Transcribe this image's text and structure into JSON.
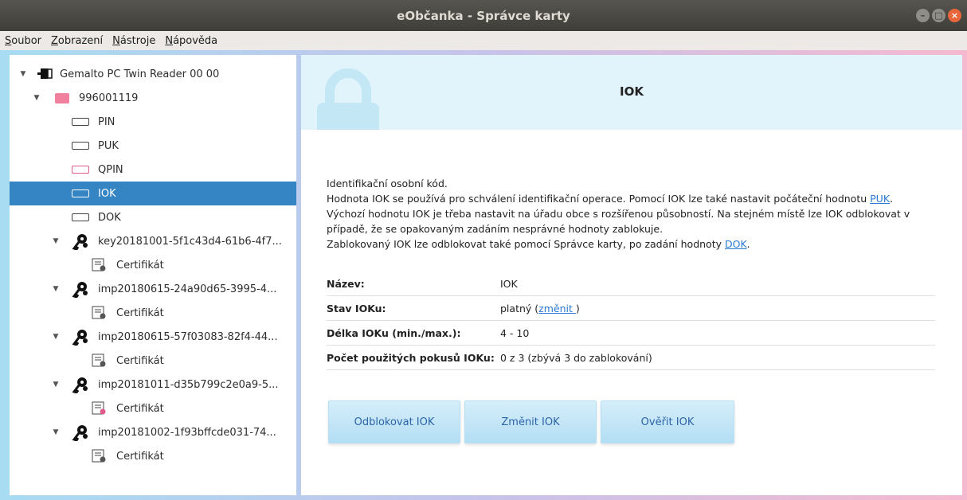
{
  "window": {
    "title": "eObčanka - Správce karty"
  },
  "menu": {
    "soubor": {
      "accel": "S",
      "rest": "oubor"
    },
    "zobrazeni": {
      "accel": "Z",
      "rest": "obrazení"
    },
    "nastroje": {
      "accel": "N",
      "rest": "ástroje"
    },
    "napoveda": {
      "accel": "N",
      "rest": "ápověda"
    }
  },
  "tree": {
    "reader": "Gemalto PC Twin Reader 00 00",
    "card": "996001119",
    "pins": [
      "PIN",
      "PUK",
      "QPIN",
      "IOK",
      "DOK"
    ],
    "keys": [
      {
        "label": "key20181001-5f1c43d4-61b6-4f7...",
        "cert": "Certifikát"
      },
      {
        "label": "imp20180615-24a90d65-3995-4...",
        "cert": "Certifikát"
      },
      {
        "label": "imp20180615-57f03083-82f4-44...",
        "cert": "Certifikát"
      },
      {
        "label": "imp20181011-d35b799c2e0a9-5...",
        "cert": "Certifikát"
      },
      {
        "label": "imp20181002-1f93bffcde031-74...",
        "cert": "Certifikát"
      }
    ]
  },
  "detail": {
    "title": "IOK",
    "desc": {
      "l1": "Identifikační osobní kód.",
      "l2_pre": "Hodnota IOK se používá pro schválení identifikační operace. Pomocí IOK lze také nastavit počáteční hodnotu ",
      "l2_link": "PUK",
      "l2_post": ".",
      "l3": "Výchozí hodnotu IOK je třeba nastavit na úřadu obce s rozšířenou působností. Na stejném místě lze IOK odblokovat v",
      "l4": "případě, že se opakovaným zadáním nesprávné hodnoty zablokuje.",
      "l5_pre": "Zablokovaný IOK lze odblokovat také pomocí Správce karty, po zadání hodnoty ",
      "l5_link": "DOK",
      "l5_post": "."
    },
    "props": {
      "name_key": "Název:",
      "name_val": "IOK",
      "state_key": "Stav IOKu:",
      "state_val": "platný (",
      "state_link": "změnit ",
      "state_end": ")",
      "len_key": "Délka IOKu (min./max.):",
      "len_val": "4 - 10",
      "tries_key": "Počet použitých pokusů IOKu:",
      "tries_val": "0 z 3 (zbývá 3 do zablokování)"
    },
    "buttons": {
      "unblock": "Odblokovat IOK",
      "change": "Změnit IOK",
      "verify": "Ověřit IOK"
    }
  }
}
